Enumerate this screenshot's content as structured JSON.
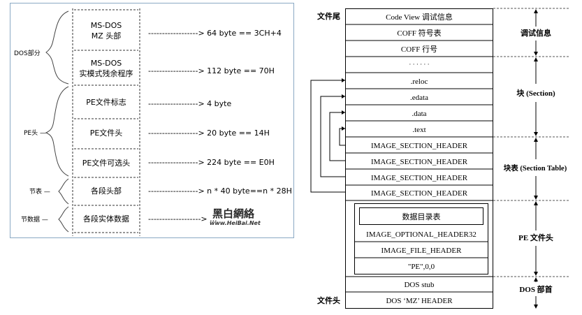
{
  "left": {
    "cells": [
      {
        "lines": [
          "MS-DOS",
          "MZ 头部"
        ],
        "size": "------------------> 64 byte == 3CH+4"
      },
      {
        "lines": [
          "MS-DOS",
          "实模式残余程序"
        ],
        "size": "------------------> 112 byte ==  70H"
      },
      {
        "lines": [
          "PE文件标志"
        ],
        "size": "------------------> 4 byte"
      },
      {
        "lines": [
          "PE文件头"
        ],
        "size": "------------------> 20 byte   == 14H"
      },
      {
        "lines": [
          "PE文件可选头"
        ],
        "size": "------------------> 224 byte   ==  E0H"
      },
      {
        "lines": [
          "各段头部"
        ],
        "size": "------------------> n * 40 byte==n * 28H"
      },
      {
        "lines": [
          "各段实体数据"
        ],
        "size": "-------------------> ..."
      }
    ],
    "groups": {
      "dos": "DOS部分",
      "pe": "PE头 —",
      "sec": "节表 —",
      "data": "节数据 —"
    },
    "watermark": {
      "top": "黑白網絡",
      "bottom": "www.HeiBai.Net"
    }
  },
  "right": {
    "labels": {
      "file_end": "文件尾",
      "file_start": "文件头"
    },
    "rows": [
      "Code View 调试信息",
      "COFF 符号表",
      "COFF 行号",
      "· · · · · ·",
      ".reloc",
      ".edata",
      ".data",
      ".text",
      "IMAGE_SECTION_HEADER",
      "IMAGE_SECTION_HEADER",
      "IMAGE_SECTION_HEADER",
      "IMAGE_SECTION_HEADER",
      "数据目录表",
      "IMAGE_OPTIONAL_HEADER32",
      "IMAGE_FILE_HEADER",
      "\"PE\",0,0",
      "DOS stub",
      "DOS ‘MZ’ HEADER"
    ],
    "brackets": {
      "debug": "调试信息",
      "section": "块 (Section)",
      "section_table": "块表 (Section Table)",
      "pe_header": "PE 文件头",
      "dos_header": "DOS 部首"
    }
  }
}
